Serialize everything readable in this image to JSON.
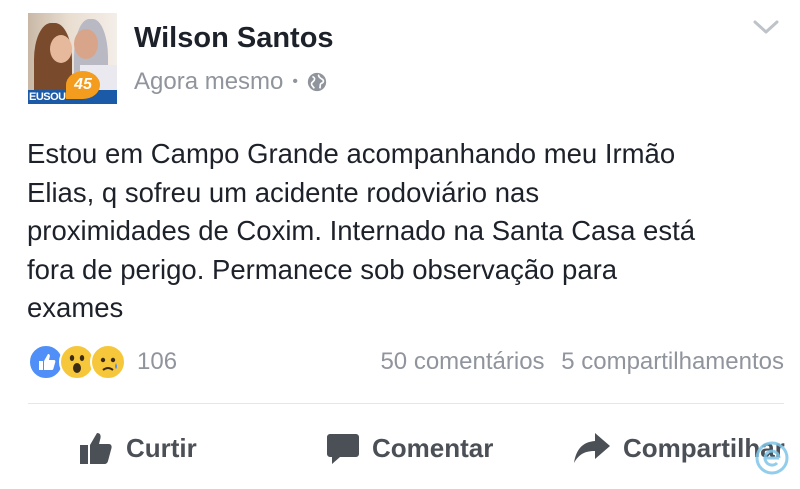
{
  "post": {
    "author": "Wilson Santos",
    "timestamp": "Agora mesmo",
    "separator": "•",
    "privacy_icon": "globe-icon",
    "avatar": {
      "badge_text": "EUSOU",
      "badge_number": "45"
    },
    "text_lines": [
      "Estou em Campo Grande acompanhando meu Irmão",
      "Elias, q sofreu um acidente rodoviário nas",
      "proximidades de Coxim. Internado na Santa Casa está",
      "fora de perigo. Permanece sob observação para",
      "exames"
    ]
  },
  "reactions": {
    "icons": [
      "like-reaction-icon",
      "wow-reaction-icon",
      "sad-reaction-icon"
    ],
    "count": "106"
  },
  "stats": {
    "comments": "50 comentários",
    "shares": "5 compartilhamentos"
  },
  "actions": {
    "like_label": "Curtir",
    "comment_label": "Comentar",
    "share_label": "Compartilhar"
  },
  "colors": {
    "text": "#1d2129",
    "muted": "#90949c",
    "action": "#4b4f56",
    "like_blue": "#4f8ff7",
    "reaction_yellow": "#f7c73b"
  }
}
